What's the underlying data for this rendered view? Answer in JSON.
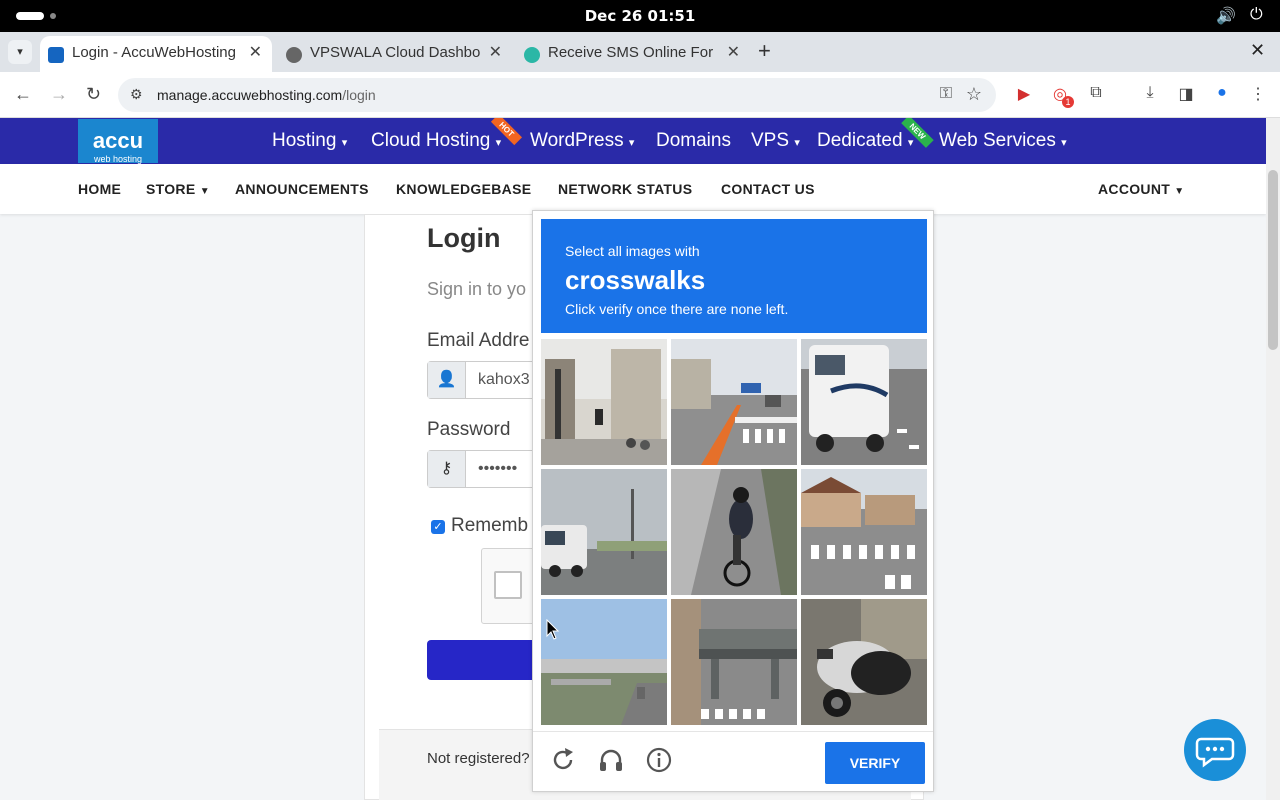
{
  "system": {
    "clock": "Dec 26  01:51"
  },
  "tabs": [
    {
      "title": "Login - AccuWebHosting",
      "active": true
    },
    {
      "title": "VPSWALA Cloud Dashbo",
      "active": false
    },
    {
      "title": "Receive SMS Online For",
      "active": false
    }
  ],
  "address": {
    "host": "manage.accuwebhosting.com",
    "path": "/login"
  },
  "extension_badge": "1",
  "logo": {
    "big": "accu",
    "small": "web hosting"
  },
  "main_nav": [
    "Hosting",
    "Cloud Hosting",
    "WordPress",
    "Domains",
    "VPS",
    "Dedicated",
    "Web Services"
  ],
  "ribbons": {
    "hot": "HOT",
    "new": "NEW"
  },
  "sub_nav": [
    "HOME",
    "STORE",
    "ANNOUNCEMENTS",
    "KNOWLEDGEBASE",
    "NETWORK STATUS",
    "CONTACT US"
  ],
  "account_label": "ACCOUNT",
  "login": {
    "title": "Login",
    "subtitle": "Sign in to yo",
    "email_label": "Email Addre",
    "email_value": "kahox3",
    "password_label": "Password",
    "password_value": "•••••••",
    "remember": "Rememb",
    "not_registered": "Not registered?"
  },
  "captcha": {
    "line1": "Select all images with",
    "keyword": "crosswalks",
    "line3": "Click verify once there are none left.",
    "verify_label": "VERIFY",
    "tiles": [
      "street-scene",
      "road-crosswalk",
      "rv-truck",
      "bus-road",
      "cyclist",
      "crosswalk-houses",
      "highway",
      "overpass",
      "motorcycle"
    ]
  },
  "colors": {
    "nav_blue": "#2a2aa8",
    "captcha_blue": "#1a73e8",
    "hot": "#f26522",
    "new": "#2bb24c"
  }
}
